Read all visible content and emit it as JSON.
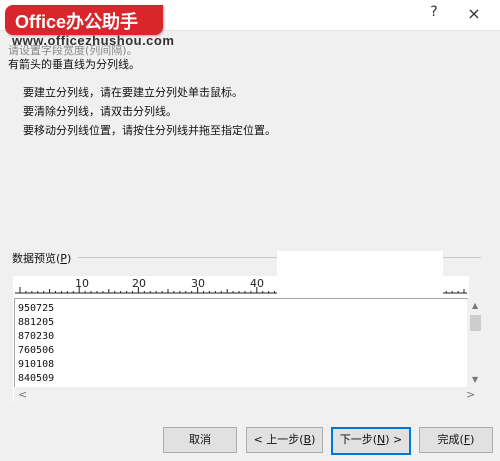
{
  "window": {
    "title": "",
    "help": "?",
    "close": "×"
  },
  "logo": {
    "text": "Office办公助手",
    "url": "www.officezhushou.com"
  },
  "instructions": {
    "line1": "请设置字段宽度(列间隔)。",
    "line2": "有箭头的垂直线为分列线。",
    "bullet1": "要建立分列线，请在要建立分列处单击鼠标。",
    "bullet2": "要清除分列线，请双击分列线。",
    "bullet3": "要移动分列线位置，请按住分列线并拖至指定位置。"
  },
  "preview": {
    "label": "数据预览(",
    "accel": "P",
    "label_end": ")",
    "ruler": [
      "10",
      "20",
      "30",
      "40"
    ],
    "rows": [
      "950725",
      "881205",
      "870230",
      "760506",
      "910108",
      "840509"
    ]
  },
  "buttons": {
    "cancel": "取消",
    "back": "< 上一步(",
    "back_key": "B",
    "next": "下一步(",
    "next_key": "N",
    "next_end": ") >",
    "finish": "完成(",
    "finish_key": "F",
    "close_paren": ")"
  }
}
